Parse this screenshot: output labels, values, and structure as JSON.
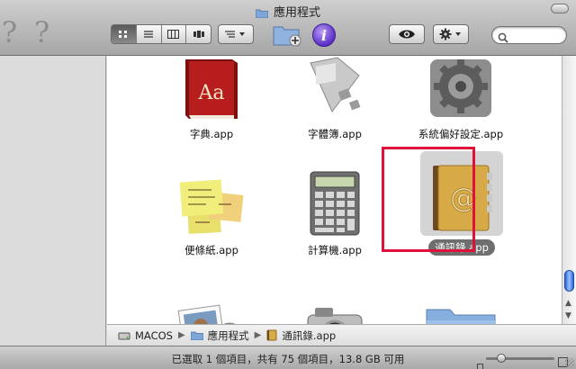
{
  "window": {
    "title": "應用程式"
  },
  "toolbar": {
    "view_modes": [
      "icon",
      "list",
      "column",
      "coverflow"
    ],
    "selected_view": "icon",
    "search_placeholder": ""
  },
  "files": [
    {
      "name": "字典.app",
      "icon": "dictionary-icon"
    },
    {
      "name": "字體簿.app",
      "icon": "font-book-icon"
    },
    {
      "name": "系統偏好設定.app",
      "icon": "system-preferences-icon"
    },
    {
      "name": "便條紙.app",
      "icon": "stickies-icon"
    },
    {
      "name": "計算機.app",
      "icon": "calculator-icon"
    },
    {
      "name": "通訊錄.app",
      "icon": "address-book-icon",
      "selected": true
    },
    {
      "name": "",
      "icon": "iphoto-icon"
    },
    {
      "name": "",
      "icon": "image-capture-icon"
    },
    {
      "name": "",
      "icon": "folder-icon"
    }
  ],
  "pathbar": {
    "items": [
      "MACOS",
      "應用程式",
      "通訊錄.app"
    ]
  },
  "status": {
    "text": "已選取 1 個項目，共有 75 個項目，13.8 GB 可用"
  },
  "colors": {
    "highlight": "#e0103a",
    "selection_label": "#6e6e6e",
    "scroll_thumb": "#2a66d8"
  }
}
